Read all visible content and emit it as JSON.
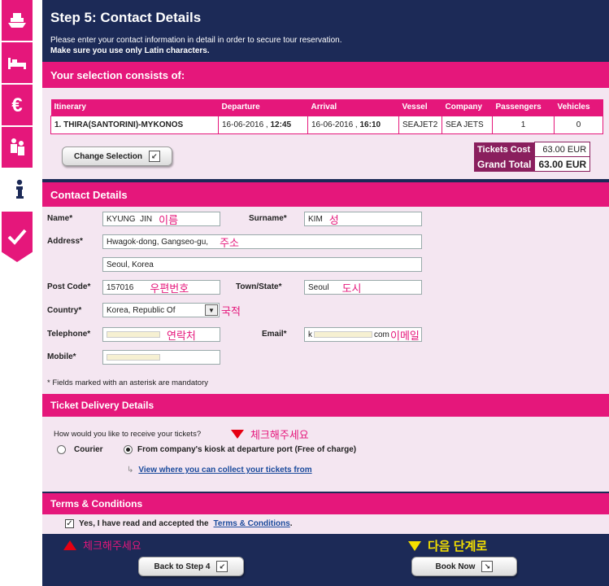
{
  "sidebar": {
    "tabs": [
      {
        "icon": "ship-icon",
        "active": false
      },
      {
        "icon": "bed-icon",
        "active": false
      },
      {
        "icon": "euro-icon",
        "active": false
      },
      {
        "icon": "people-icon",
        "active": false
      },
      {
        "icon": "info-icon",
        "active": true
      },
      {
        "icon": "check-icon",
        "active": false
      }
    ]
  },
  "header": {
    "title": "Step 5: Contact Details",
    "intro_line1": "Please enter your contact information in detail in order to secure tour reservation.",
    "intro_line2": "Make sure you use only Latin characters."
  },
  "selection": {
    "heading": "Your selection consists of:",
    "columns": [
      "Itinerary",
      "Departure",
      "Arrival",
      "Vessel",
      "Company",
      "Passengers",
      "Vehicles"
    ],
    "row": {
      "itinerary": "1. THIRA(SANTORINI)-MYKONOS",
      "departure_date": "16-06-2016 ,",
      "departure_time": "12:45",
      "arrival_date": "16-06-2016 ,",
      "arrival_time": "16:10",
      "vessel": "SEAJET2",
      "company": "SEA JETS",
      "passengers": "1",
      "vehicles": "0"
    },
    "change_button": "Change Selection",
    "tickets_cost_label": "Tickets Cost",
    "tickets_cost_value": "63.00 EUR",
    "grand_total_label": "Grand Total",
    "grand_total_value": "63.00 EUR"
  },
  "contact": {
    "heading": "Contact Details",
    "name_label": "Name*",
    "name_value": "KYUNG  JIN",
    "name_hint": "이름",
    "surname_label": "Surname*",
    "surname_value": "KIM",
    "surname_hint": "성",
    "address_label": "Address*",
    "address1_value": "Hwagok-dong, Gangseo-gu,",
    "address_hint": "주소",
    "address2_value": "Seoul, Korea",
    "postcode_label": "Post Code*",
    "postcode_value": "157016",
    "postcode_hint": "우편번호",
    "town_label": "Town/State*",
    "town_value": "Seoul",
    "town_hint": "도시",
    "country_label": "Country*",
    "country_value": "Korea, Republic Of",
    "country_hint": "국적",
    "telephone_label": "Telephone*",
    "telephone_hint": "연락처",
    "email_label": "Email*",
    "email_prefix": "k",
    "email_suffix": "com",
    "email_hint": "이메일",
    "mobile_label": "Mobile*",
    "mandatory_note": "* Fields marked with an asterisk are mandatory"
  },
  "delivery": {
    "heading": "Ticket Delivery Details",
    "question": "How would you like to receive your tickets?",
    "check_hint": "체크해주세요",
    "option_courier": "Courier",
    "option_kiosk": "From company's kiosk at departure port (Free of charge)",
    "selected": "kiosk",
    "view_link": "View where you can collect your tickets from"
  },
  "terms": {
    "heading": "Terms & Conditions",
    "accept_prefix": "Yes, I have read and accepted the",
    "accept_link": "Terms & Conditions",
    "accept_suffix": ".",
    "checked": true
  },
  "footer": {
    "check_hint": "체크해주세요",
    "next_hint": "다음 단계로",
    "back_button": "Back to Step 4",
    "book_button": "Book Now"
  },
  "colors": {
    "navy": "#1c2a57",
    "pink": "#e5177b",
    "panel": "#f4e6f1",
    "cost_label": "#8a1f5e",
    "link": "#1a4a9c",
    "hint_yellow": "#f5e000"
  }
}
